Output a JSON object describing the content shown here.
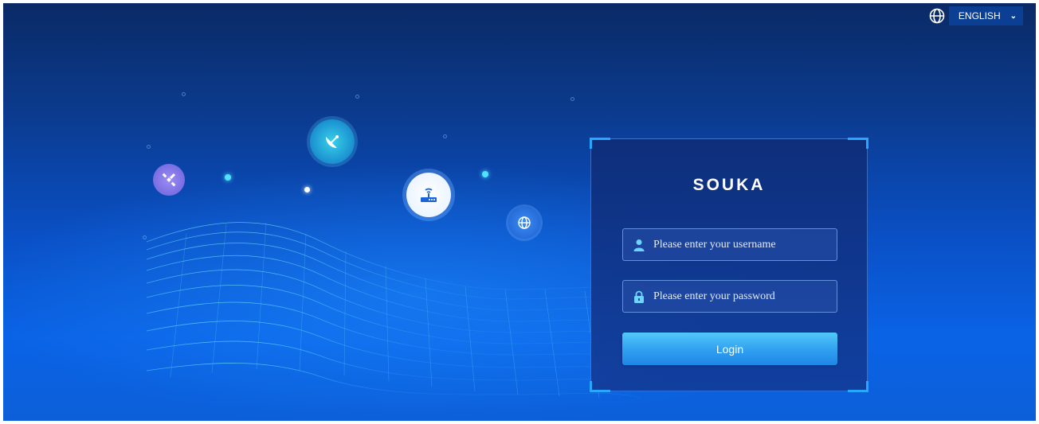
{
  "language": {
    "selected": "ENGLISH",
    "globe_icon": "globe-icon",
    "chevron_icon": "chevron-down-icon"
  },
  "decor": {
    "icons": [
      "satellite-icon",
      "satellite-dish-icon",
      "router-icon",
      "globe-icon"
    ]
  },
  "login": {
    "brand": "SOUKA",
    "username": {
      "placeholder": "Please enter your username",
      "value": "",
      "icon": "user-icon"
    },
    "password": {
      "placeholder": "Please enter your password",
      "value": "",
      "icon": "lock-icon"
    },
    "submit_label": "Login"
  },
  "colors": {
    "accent": "#29a7ff",
    "button": "#2f9ff0",
    "background": "#0a4fc4"
  }
}
